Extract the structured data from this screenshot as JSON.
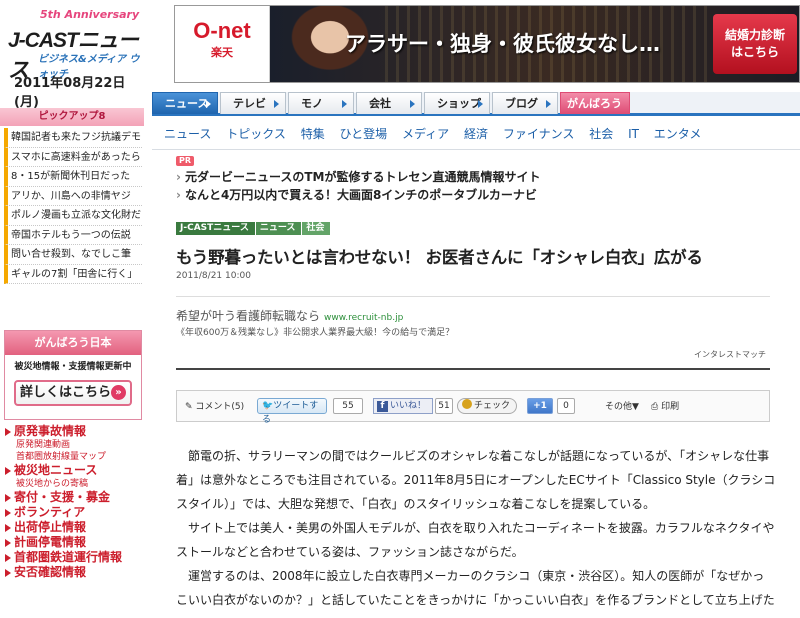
{
  "left": {
    "anniversary": "5th Anniversary",
    "logo": "J-CASTニュース",
    "logo_sub": "ビジネス&メディア ウォッチ",
    "date": "2011年08月22日(月)",
    "pickup_title": "ピックアップ8",
    "pickup_items": [
      "韓国記者も来たフジ抗議デモ",
      "スマホに高速料金があったら",
      "8・15が新聞休刊日だった",
      "アリか、川島への非情ヤジ",
      "ポルノ漫画も立派な文化財だ",
      "帝国ホテルもう一つの伝説",
      "問い合せ殺到、なでしこ筆",
      "ギャルの7割「田舎に行く」"
    ],
    "gambaro_title": "がんばろう日本",
    "gambaro_info": "被災地情報・支援情報更新中",
    "gambaro_button": "詳しくはこちら",
    "gambaro_arrow": "»",
    "links": [
      {
        "label": "原発事故情報",
        "subs": [
          "原発関連動画",
          "首都圏放射線量マップ"
        ]
      },
      {
        "label": "被災地ニュース",
        "subs": [
          "被災地からの寄稿"
        ]
      },
      {
        "label": "寄付・支援・募金",
        "subs": []
      },
      {
        "label": "ボランティア",
        "subs": []
      },
      {
        "label": "出荷停止情報",
        "subs": []
      },
      {
        "label": "計画停電情報",
        "subs": []
      },
      {
        "label": "首都圏鉄道運行情報",
        "subs": []
      },
      {
        "label": "安否確認情報",
        "subs": []
      }
    ]
  },
  "banner": {
    "brand": "O-net",
    "brand_sub": "楽天",
    "headline": "アラサー・独身・彼氏彼女なし…",
    "button": "結婚力診断\nはこちら"
  },
  "tabs": [
    "ニュース",
    "テレビ",
    "モノ",
    "会社",
    "ショップ",
    "ブログ",
    "がんばろう日本"
  ],
  "categories": [
    "ニュース",
    "トピックス",
    "特集",
    "ひと登場",
    "メディア",
    "経済",
    "ファイナンス",
    "社会",
    "IT",
    "エンタメ"
  ],
  "pr": {
    "badge": "PR",
    "lines": [
      "元ダービーニュースのTMが監修するトレセン直通競馬情報サイト",
      "なんと4万円以内で買える！大画面8インチのポータブルカーナビ"
    ]
  },
  "breadcrumb": [
    "J-CASTニュース",
    "ニュース",
    "社会"
  ],
  "article": {
    "headline": "もう野暮ったいとは言わせない！ お医者さんに「オシャレ白衣」広がる",
    "date": "2011/8/21 10:00",
    "ad_title": "希望が叶う看護師転職なら",
    "ad_url": "www.recruit-nb.jp",
    "ad_desc": "《年収600万＆残業なし》非公開求人業界最大級！今の給与で満足？",
    "ad_label": "インタレストマッチ",
    "share": {
      "comment": "コメント(5)",
      "tweet": "ツイートする",
      "tweet_count": "55",
      "like": "いいね！",
      "like_count": "51",
      "check": "チェック",
      "plus": "+1",
      "plus_count": "0",
      "other": "その他▼",
      "print": "印刷"
    },
    "paragraphs": [
      "節電の折、サラリーマンの間ではクールビズのオシャレな着こなしが話題になっているが、「オシャレな仕事着」は意外なところでも注目されている。2011年8月5日にオープンしたECサイト「Classico Style（クラシコスタイル）」では、大胆な発想で、「白衣」のスタイリッシュな着こなしを提案している。",
      "サイト上では美人・美男の外国人モデルが、白衣を取り入れたコーディネートを披露。カラフルなネクタイやストールなどと合わせている姿は、ファッション誌さながらだ。",
      "運営するのは、2008年に設立した白衣専門メーカーのクラシコ（東京・渋谷区）。知人の医師が「なぜかっこいい白衣がないのか？」と話していたことをきっかけに「かっこいい白衣」を作るブランドとして立ち上げたという。"
    ]
  }
}
